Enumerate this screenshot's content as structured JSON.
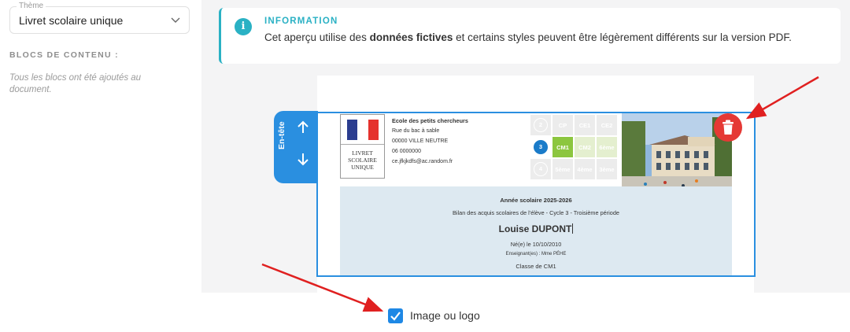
{
  "sidebar": {
    "theme_legend": "Thème",
    "theme_value": "Livret scolaire unique",
    "blocks_title": "BLOCS DE CONTENU :",
    "blocks_note": "Tous les blocs ont été ajoutés au document."
  },
  "info_banner": {
    "title": "INFORMATION",
    "text_before": "Cet aperçu utilise des ",
    "text_bold": "données fictives",
    "text_after": " et certains styles peuvent être légèrement différents sur la version PDF."
  },
  "section_tab": {
    "label": "En-tête"
  },
  "header_block": {
    "logo_text": [
      "LIVRET",
      "SCOLAIRE",
      "UNIQUE"
    ],
    "school": {
      "name": "Ecole des petits chercheurs",
      "street": "Rue du bac à sable",
      "city": "00000 VILLE NEUTRE",
      "phone": "06 0000000",
      "email": "ce.jfkjkdfs@ac.random.fr"
    },
    "cycle_grid": [
      [
        "2",
        "CP",
        "CE1",
        "CE2"
      ],
      [
        "3",
        "CM1",
        "CM2",
        "6ème"
      ],
      [
        "4",
        "5ème",
        "4ème",
        "3ème"
      ]
    ]
  },
  "student": {
    "school_year": "Année scolaire 2025-2026",
    "bilan": "Bilan des acquis scolaires de l'élève - Cycle 3 - Troisième période",
    "name": "Louise DUPONT",
    "birth": "Né(e) le 10/10/2010",
    "teacher": "Enseignant(es) : Mme PÉHE",
    "class": "Classe de CM1"
  },
  "bottom": {
    "checkbox_label": "Image ou logo",
    "checkbox_checked": true
  },
  "colors": {
    "accent": "#2a8fe0",
    "info": "#2ab1c4",
    "delete": "#e53935",
    "lime": "#8cc63f",
    "annotation": "#e02020"
  },
  "icons": [
    "chevron-down-icon",
    "info-icon",
    "arrow-up-icon",
    "arrow-down-icon",
    "trash-icon",
    "check-icon"
  ]
}
